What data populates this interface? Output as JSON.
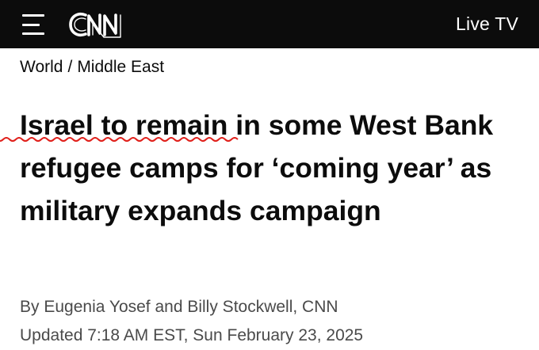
{
  "header": {
    "logo_text": "CNN",
    "live_tv_label": "Live TV",
    "menu_icon": "hamburger-menu-icon"
  },
  "breadcrumb": {
    "section": "World",
    "separator": "/",
    "subsection": "Middle East"
  },
  "article": {
    "headline_marked": "Israel to remain",
    "headline_rest": " in some West Bank refugee camps for ‘coming year’ as military expands campaign",
    "byline": "By Eugenia Yosef and Billy Stockwell, CNN",
    "timestamp": "Updated 7:18 AM EST, Sun February 23, 2025"
  },
  "colors": {
    "header_bg": "#0c0c0c",
    "text": "#0c0c0c",
    "meta_text": "#4a4a4a",
    "squiggle": "#e0201b"
  }
}
